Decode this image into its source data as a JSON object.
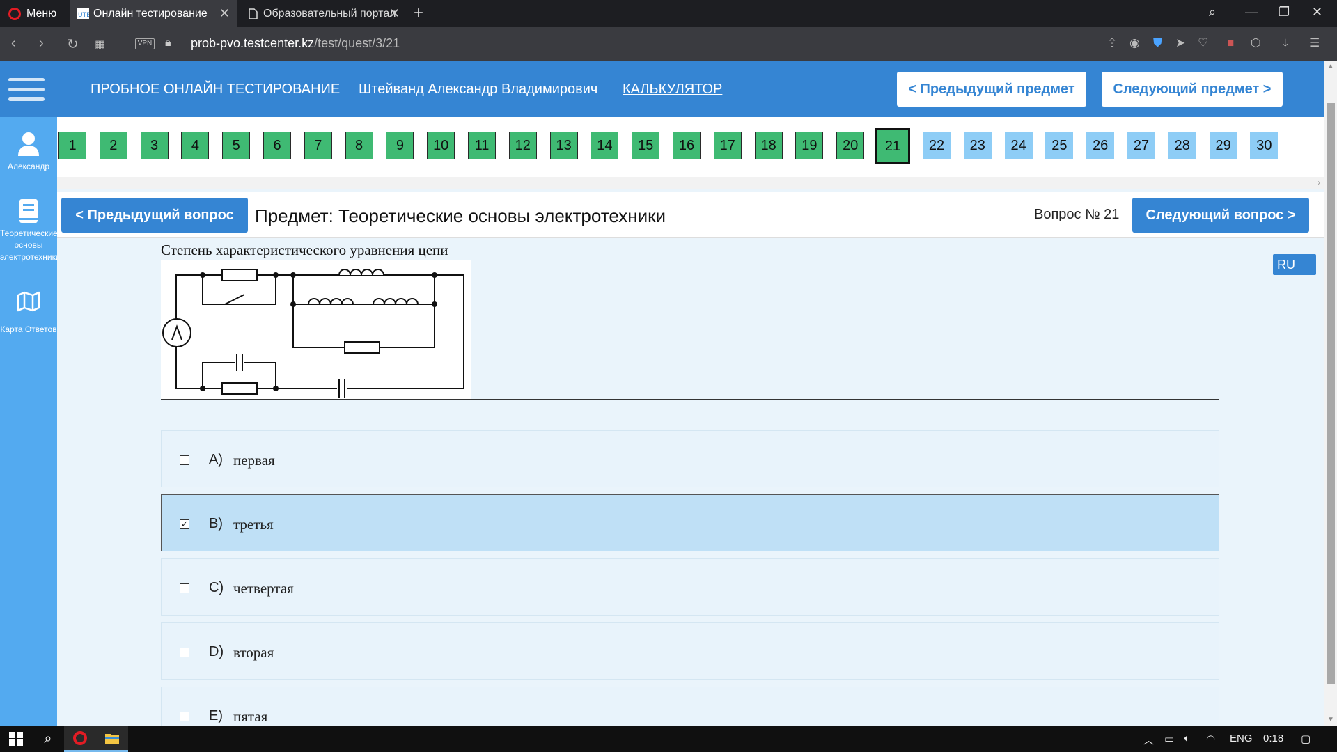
{
  "browser": {
    "menu_label": "Меню",
    "tabs": [
      {
        "title": "Онлайн тестирование",
        "active": true
      },
      {
        "title": "Образовательный портал",
        "active": false
      }
    ],
    "vpn_label": "VPN",
    "url_host": "prob-pvo.testcenter.kz",
    "url_path": "/test/quest/3/21"
  },
  "header": {
    "title": "ПРОБНОЕ ОНЛАЙН ТЕСТИРОВАНИЕ",
    "user_name": "Штейванд Александр Владимирович",
    "calculator_label": "КАЛЬКУЛЯТОР",
    "prev_subject_label": "< Предыдущий предмет",
    "next_subject_label": "Следующий предмет >"
  },
  "sidebar": {
    "items": [
      {
        "icon": "user-icon",
        "label": "Александр"
      },
      {
        "icon": "book-icon",
        "label": "Теоретические основы электротехники"
      },
      {
        "icon": "map-icon",
        "label": "Карта Ответов"
      }
    ]
  },
  "question_nav": {
    "numbers": [
      "1",
      "2",
      "3",
      "4",
      "5",
      "6",
      "7",
      "8",
      "9",
      "10",
      "11",
      "12",
      "13",
      "14",
      "15",
      "16",
      "17",
      "18",
      "19",
      "20",
      "21",
      "22",
      "23",
      "24",
      "25",
      "26",
      "27",
      "28",
      "29",
      "30"
    ],
    "answered_count": 20,
    "current": "21",
    "colors": {
      "answered": "#3fba73",
      "unanswered": "#8ecdf6"
    }
  },
  "question": {
    "prev_label": "< Предыдущий вопрос",
    "next_label": "Следующий вопрос >",
    "subject": "Предмет: Теоретические основы электротехники",
    "number_label": "Вопрос № 21",
    "text": "Степень характеристического уравнения цепи",
    "lang": "RU",
    "answers": [
      {
        "letter": "A)",
        "text": "первая",
        "checked": false
      },
      {
        "letter": "B)",
        "text": "третья",
        "checked": true
      },
      {
        "letter": "C)",
        "text": "четвертая",
        "checked": false
      },
      {
        "letter": "D)",
        "text": "вторая",
        "checked": false
      },
      {
        "letter": "E)",
        "text": "пятая",
        "checked": false
      }
    ]
  },
  "taskbar": {
    "lang": "ENG",
    "time": "0:18"
  },
  "colors": {
    "accent": "#3585d3",
    "sidebar": "#53aaf0",
    "selected_answer": "#bfe0f6"
  }
}
